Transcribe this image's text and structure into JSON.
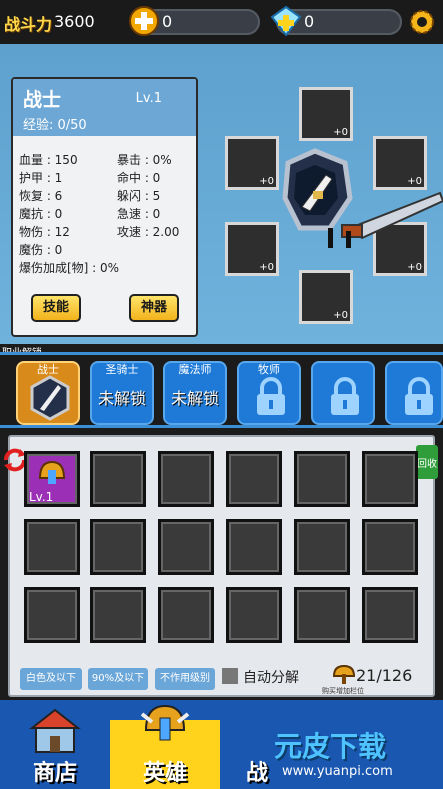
{
  "header": {
    "power_label": "战斗力",
    "power_value": "3600",
    "gold_value": "0",
    "gem_value": "0"
  },
  "hero": {
    "class_name": "战士",
    "level": "Lv.1",
    "exp": "经验: 0/50",
    "stats": [
      "血量 : 150",
      "暴击 : 0%",
      "护甲 : 1",
      "命中 : 0",
      "恢复 : 6",
      "躲闪 : 5",
      "魔抗 : 0",
      "急速 : 0",
      "物伤 : 12",
      "攻速 : 2.00",
      "魔伤 : 0",
      "爆伤加成[物] : 0%"
    ],
    "skill_button": "技能",
    "artifact_button": "神器",
    "equip_plus": "+0"
  },
  "classes": {
    "section_label": "职业解锁",
    "tiles": [
      {
        "name": "战士",
        "locked_text": ""
      },
      {
        "name": "圣骑士",
        "locked_text": "未解锁"
      },
      {
        "name": "魔法师",
        "locked_text": "未解锁"
      },
      {
        "name": "牧师",
        "locked_text": ""
      },
      {
        "name": "",
        "locked_text": ""
      },
      {
        "name": "",
        "locked_text": ""
      }
    ]
  },
  "bag": {
    "item_level": "Lv.1",
    "recycle_label": "回收",
    "filter_white": "白色及以下",
    "filter_90": "90%及以下",
    "filter_level": "不作用级别",
    "auto_decompose": "自动分解",
    "capacity": "21/126",
    "capacity_hint": "购买增加栏位"
  },
  "nav": {
    "shop": "商店",
    "hero": "英雄",
    "battle": "战"
  },
  "watermark": {
    "text": "元皮下载",
    "url": "www.yuanpi.com"
  },
  "colors": {
    "accent_blue": "#1e7ad6",
    "panel_blue": "#6fb3dd",
    "button_yellow": "#f2b31b",
    "item_purple": "#9b2fb6"
  }
}
